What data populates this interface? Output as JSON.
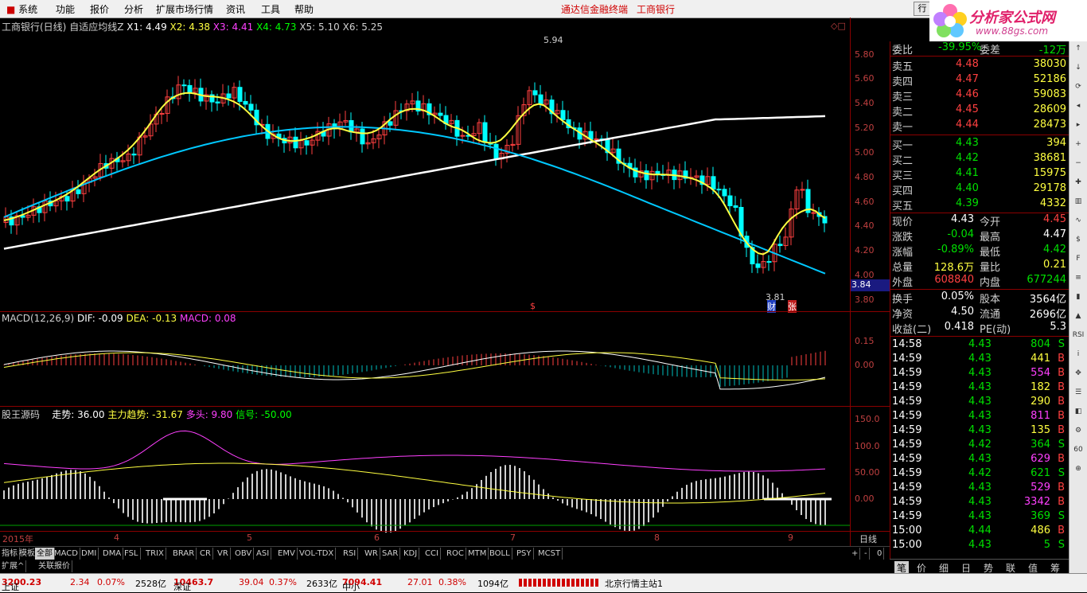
{
  "menubar": {
    "items": [
      "系统",
      "功能",
      "报价",
      "分析",
      "扩展市场行情",
      "资讯",
      "工具",
      "帮助"
    ],
    "app_title": "通达信金融终端",
    "stock_title": "工商银行",
    "right_button": "行"
  },
  "logo": {
    "line1": "分析家公式网",
    "line2": "www.88gs.com"
  },
  "kline": {
    "header_name": "工商银行(日线)",
    "header_indicator": "自适应均线Z",
    "ma_labels": [
      "X1: 4.49",
      "X2: 4.38",
      "X3: 4.41",
      "X4: 4.73",
      "X5: 5.10",
      "X6: 5.25"
    ],
    "y_ticks": [
      "5.80",
      "5.60",
      "5.40",
      "5.20",
      "5.00",
      "4.80",
      "4.60",
      "4.40",
      "4.20",
      "4.00",
      "3.80"
    ],
    "high_label": "5.94",
    "low_label": "3.81",
    "cursor_price": "3.84",
    "marks": [
      "财",
      "张"
    ],
    "dollar_mark": "$"
  },
  "macd": {
    "header": "MACD(12,26,9)",
    "dif": "DIF: -0.09",
    "dea": "DEA: -0.13",
    "macd": "MACD: 0.08",
    "y_ticks": [
      "0.15",
      "0.00"
    ]
  },
  "gw": {
    "header": "股王源码",
    "zoushi": "走势: 36.00",
    "zhuli": "主力趋势: -31.67",
    "duotou": "多头: 9.80",
    "xinhao": "信号: -50.00",
    "y_ticks": [
      "150.0",
      "100.0",
      "50.00",
      "0.00"
    ]
  },
  "datebar": {
    "year": "2015年",
    "months": [
      "4",
      "5",
      "6",
      "7",
      "8",
      "9"
    ],
    "period": "日线"
  },
  "tabs": {
    "items": [
      "指标",
      "模板",
      "全部",
      "MACD",
      "DMI",
      "DMA",
      "FSL",
      "TRIX",
      "BRAR",
      "CR",
      "VR",
      "OBV",
      "ASI",
      "EMV",
      "VOL-TDX",
      "RSI",
      "WR",
      "SAR",
      "KDJ",
      "CCI",
      "ROC",
      "MTM",
      "BOLL",
      "PSY",
      "MCST"
    ],
    "active": "全部",
    "controls": [
      "+",
      "-",
      "0"
    ]
  },
  "subtabs": {
    "items": [
      "扩展^",
      "关联报价"
    ]
  },
  "panel": {
    "weibi_label": "委比",
    "weibi_value": "-39.95%",
    "weicha_label": "委差",
    "weicha_value": "-12万",
    "sells": [
      {
        "label": "卖五",
        "price": "4.48",
        "vol": "38030"
      },
      {
        "label": "卖四",
        "price": "4.47",
        "vol": "52186"
      },
      {
        "label": "卖三",
        "price": "4.46",
        "vol": "59083"
      },
      {
        "label": "卖二",
        "price": "4.45",
        "vol": "28609"
      },
      {
        "label": "卖一",
        "price": "4.44",
        "vol": "28473"
      }
    ],
    "buys": [
      {
        "label": "买一",
        "price": "4.43",
        "vol": "394"
      },
      {
        "label": "买二",
        "price": "4.42",
        "vol": "38681"
      },
      {
        "label": "买三",
        "price": "4.41",
        "vol": "15975"
      },
      {
        "label": "买四",
        "price": "4.40",
        "vol": "29178"
      },
      {
        "label": "买五",
        "price": "4.39",
        "vol": "4332"
      }
    ],
    "stats": [
      {
        "l1": "现价",
        "v1": "4.43",
        "l2": "今开",
        "v2": "4.45"
      },
      {
        "l1": "涨跌",
        "v1": "-0.04",
        "l2": "最高",
        "v2": "4.47"
      },
      {
        "l1": "涨幅",
        "v1": "-0.89%",
        "l2": "最低",
        "v2": "4.42"
      },
      {
        "l1": "总量",
        "v1": "128.6万",
        "l2": "量比",
        "v2": "0.21"
      },
      {
        "l1": "外盘",
        "v1": "608840",
        "l2": "内盘",
        "v2": "677244"
      }
    ],
    "fund": [
      {
        "l1": "换手",
        "v1": "0.05%",
        "l2": "股本",
        "v2": "3564亿"
      },
      {
        "l1": "净资",
        "v1": "4.50",
        "l2": "流通",
        "v2": "2696亿"
      },
      {
        "l1": "收益(二)",
        "v1": "0.418",
        "l2": "PE(动)",
        "v2": "5.3"
      }
    ],
    "ticks": [
      {
        "t": "14:58",
        "p": "4.43",
        "v": "804",
        "bs": "S"
      },
      {
        "t": "14:59",
        "p": "4.43",
        "v": "441",
        "bs": "B"
      },
      {
        "t": "14:59",
        "p": "4.43",
        "v": "554",
        "bs": "B"
      },
      {
        "t": "14:59",
        "p": "4.43",
        "v": "182",
        "bs": "B"
      },
      {
        "t": "14:59",
        "p": "4.43",
        "v": "290",
        "bs": "B"
      },
      {
        "t": "14:59",
        "p": "4.43",
        "v": "811",
        "bs": "B"
      },
      {
        "t": "14:59",
        "p": "4.43",
        "v": "135",
        "bs": "B"
      },
      {
        "t": "14:59",
        "p": "4.42",
        "v": "364",
        "bs": "S"
      },
      {
        "t": "14:59",
        "p": "4.43",
        "v": "629",
        "bs": "B"
      },
      {
        "t": "14:59",
        "p": "4.42",
        "v": "621",
        "bs": "S"
      },
      {
        "t": "14:59",
        "p": "4.43",
        "v": "529",
        "bs": "B"
      },
      {
        "t": "14:59",
        "p": "4.43",
        "v": "3342",
        "bs": "B"
      },
      {
        "t": "14:59",
        "p": "4.43",
        "v": "369",
        "bs": "S"
      },
      {
        "t": "15:00",
        "p": "4.44",
        "v": "486",
        "bs": "B"
      },
      {
        "t": "15:00",
        "p": "4.43",
        "v": "5",
        "bs": "S"
      }
    ],
    "bottom_tabs": [
      "笔",
      "价",
      "细",
      "日",
      "势",
      "联",
      "值",
      "筹"
    ]
  },
  "status": {
    "sh_label": "上证",
    "sh_value": "3200.23",
    "sh_chg": "2.34",
    "sh_pct": "0.07%",
    "sh_amt": "2528亿",
    "sz_label": "深证",
    "sz_value": "10463.7",
    "sz_chg": "39.04",
    "sz_pct": "0.37%",
    "sz_amt": "2633亿",
    "zx_label": "中小",
    "zx_value": "7094.41",
    "zx_chg": "27.01",
    "zx_pct": "0.38%",
    "zx_amt": "1094亿",
    "station": "北京行情主站1"
  },
  "colors": {
    "up": "#ff4040",
    "down": "#00ffff",
    "ma_yellow": "#ffff40",
    "ma_white": "#ffffff",
    "ma_cyan": "#00c8ff"
  }
}
